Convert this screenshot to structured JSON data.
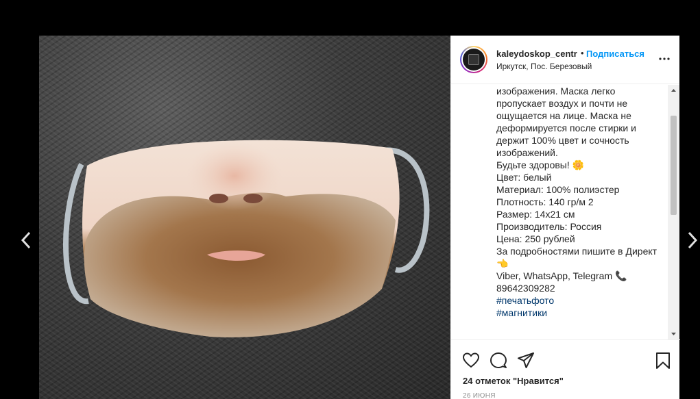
{
  "nav": {
    "prev_icon": "chevron-left-icon",
    "next_icon": "chevron-right-icon"
  },
  "header": {
    "username": "kaleydoskop_centr",
    "separator": "•",
    "follow_label": "Подписаться",
    "location": "Иркутск, Пос. Березовый",
    "more_icon": "more-horizontal-icon"
  },
  "caption": {
    "lines": [
      "изображения. Маска легко",
      "пропускает воздух и почти не",
      "ощущается на лице. Маска не",
      "деформируется после стирки и",
      "держит 100% цвет и сочность",
      "изображений.",
      "Будьте здоровы! 🌼",
      "",
      "Цвет: белый",
      "Материал: 100% полиэстер",
      "Плотность: 140 гр/м 2",
      "Размер: 14х21 см",
      "Производитель: Россия",
      "Цена: 250 рублей",
      "За подробностями пишите в Директ",
      "👈",
      "Viber, WhatsApp, Telegram 📞",
      "89642309282",
      ""
    ],
    "hashtags": [
      "#печатьфото",
      "#магнитики"
    ]
  },
  "actions": {
    "like_icon": "heart-icon",
    "comment_icon": "comment-icon",
    "share_icon": "share-icon",
    "save_icon": "bookmark-icon",
    "likes_text": "24 отметок \"Нравится\"",
    "date": "26 ИЮНЯ"
  },
  "colors": {
    "follow": "#0095f6",
    "hashtag": "#00376b",
    "text": "#262626",
    "muted": "#8e8e8e"
  }
}
